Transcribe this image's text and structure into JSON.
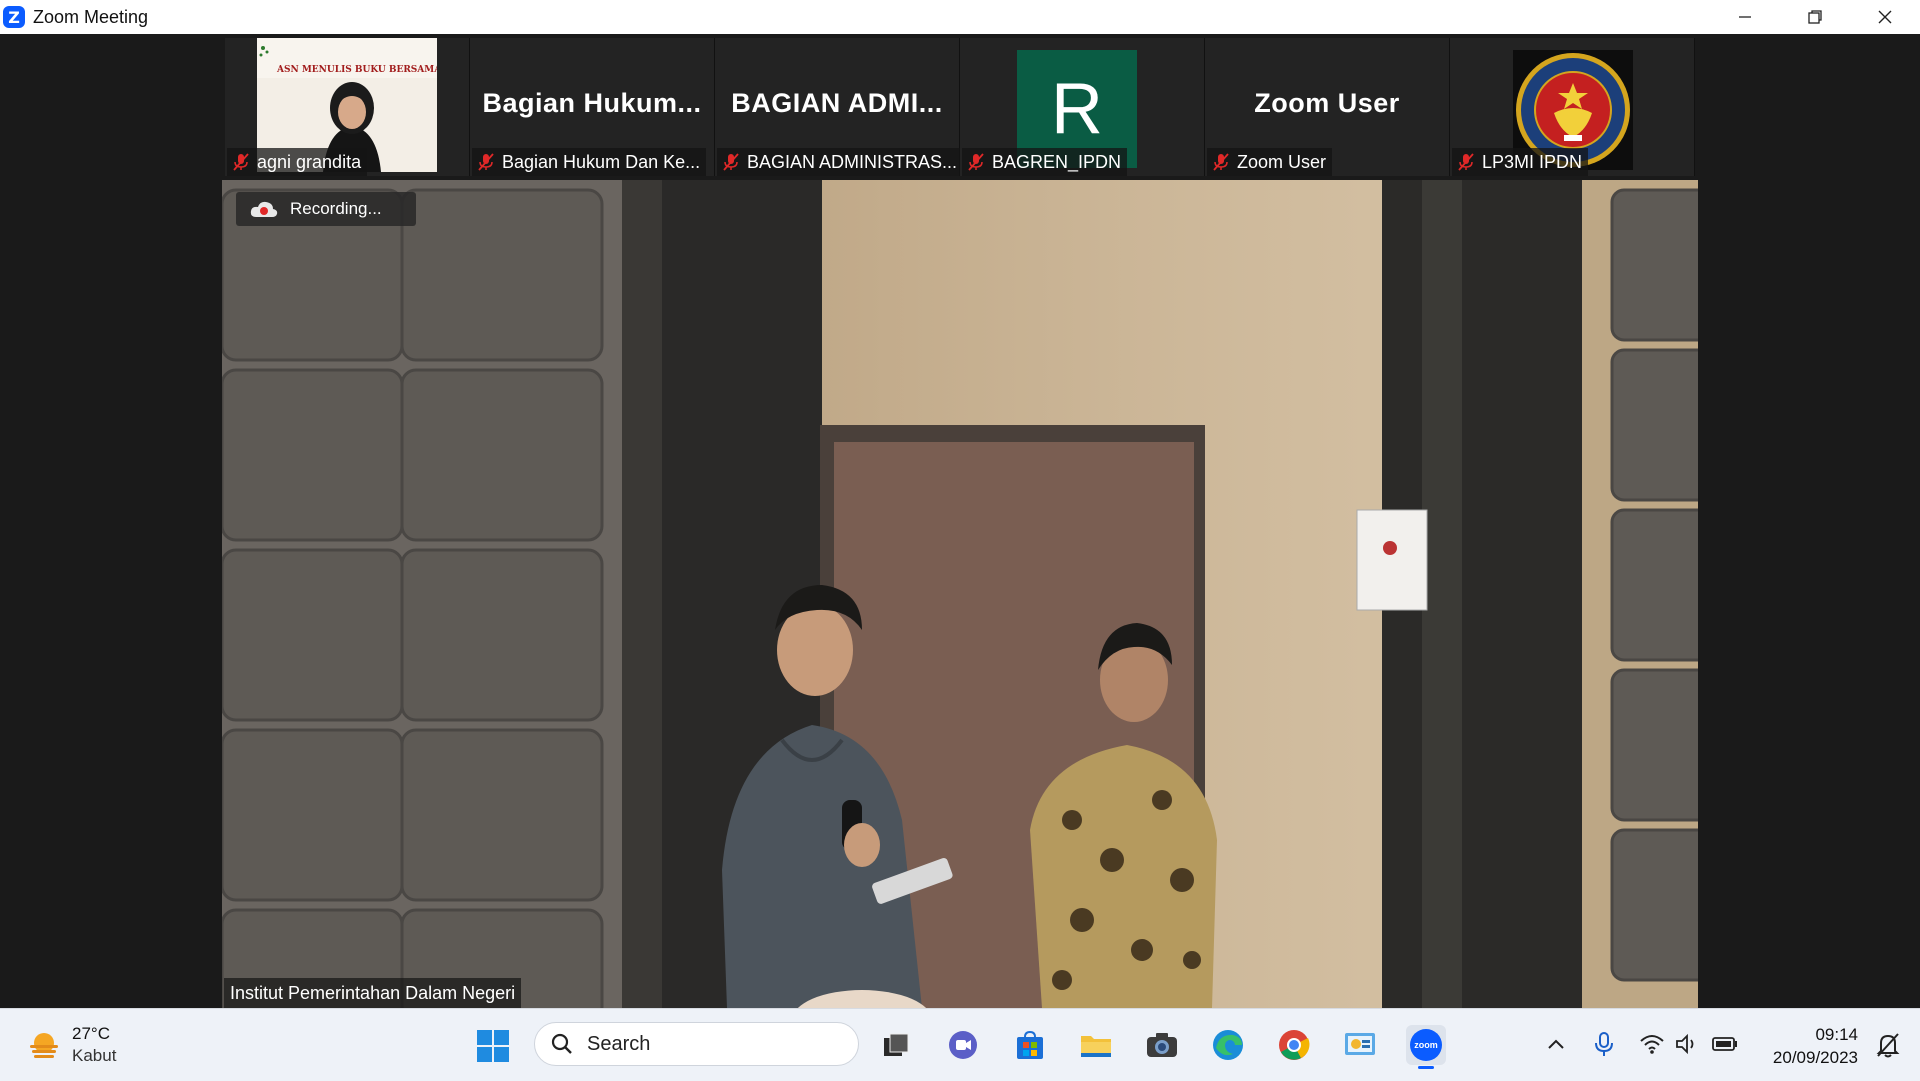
{
  "window": {
    "title": "Zoom Meeting",
    "brand_color": "#0b5cff"
  },
  "participants": [
    {
      "name": "agni grandita",
      "display": "",
      "banner": "ASN MENULIS BUKU BERSAMA"
    },
    {
      "name": "Bagian Hukum Dan Ke...",
      "display": "Bagian  Hukum..."
    },
    {
      "name": "BAGIAN ADMINISTRAS...",
      "display": "BAGIAN  ADMI..."
    },
    {
      "name": "BAGREN_IPDN",
      "display": "R",
      "avatar_color": "#0a5c44"
    },
    {
      "name": "Zoom User",
      "display": "Zoom User"
    },
    {
      "name": "LP3MI IPDN",
      "display": ""
    }
  ],
  "main": {
    "recording_label": "Recording...",
    "speaker_name": "Institut Pemerintahan Dalam Negeri"
  },
  "taskbar": {
    "weather": {
      "temp": "27°C",
      "condition": "Kabut"
    },
    "search_placeholder": "Search",
    "apps": [
      "task-view",
      "teams-chat",
      "microsoft-store",
      "file-explorer",
      "camera",
      "edge",
      "chrome",
      "control-panel",
      "zoom"
    ],
    "zoom_label": "zoom",
    "clock": {
      "time": "09:14",
      "date": "20/09/2023"
    }
  }
}
